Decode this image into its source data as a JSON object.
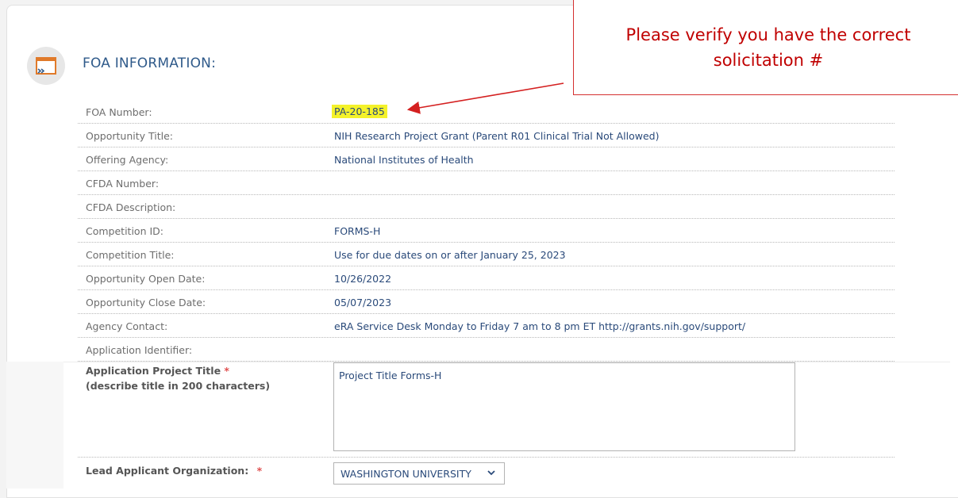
{
  "section": {
    "title": "FOA INFORMATION:"
  },
  "rows": [
    {
      "label": "FOA Number:",
      "value": "PA-20-185"
    },
    {
      "label": "Opportunity Title:",
      "value": "NIH Research Project Grant (Parent R01 Clinical Trial Not Allowed)"
    },
    {
      "label": "Offering Agency:",
      "value": "National Institutes of Health"
    },
    {
      "label": "CFDA Number:",
      "value": ""
    },
    {
      "label": "CFDA Description:",
      "value": ""
    },
    {
      "label": "Competition ID:",
      "value": "FORMS-H"
    },
    {
      "label": "Competition Title:",
      "value": "Use for due dates on or after January 25, 2023"
    },
    {
      "label": "Opportunity Open Date:",
      "value": "10/26/2022"
    },
    {
      "label": "Opportunity Close Date:",
      "value": "05/07/2023"
    },
    {
      "label": "Agency Contact:",
      "value": "eRA Service Desk Monday to Friday 7 am to 8 pm ET http://grants.nih.gov/support/"
    },
    {
      "label": "Application Identifier:",
      "value": ""
    }
  ],
  "form": {
    "project_title_label": "Application Project Title",
    "project_title_hint": "(describe title in 200 characters)",
    "project_title_value": "Project Title Forms-H",
    "org_label": "Lead Applicant Organization:",
    "org_value": "WASHINGTON UNIVERSITY",
    "required_mark": "*"
  },
  "callout": {
    "line1": "Please verify you have the correct",
    "line2": "solicitation #"
  },
  "colors": {
    "accent": "#2f5a8a",
    "highlight": "#f4f22a",
    "callout_red": "#c00000"
  }
}
